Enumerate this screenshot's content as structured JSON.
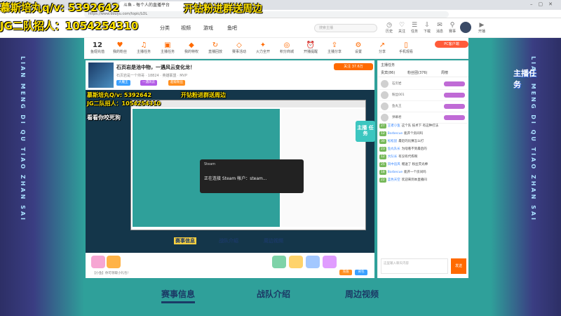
{
  "browser": {
    "tab_title": "斗鱼 - 每个人的直播平台",
    "url": "https://www.douyu.com/topic/LOL"
  },
  "overlay": {
    "line1_left": "慕斯培丸q/v:  5392642",
    "line1_right": "开钻粉进群送周边",
    "line2": "JG二队招人：1054254310",
    "inner_line1": "慕斯培丸Q/v: 5392642",
    "inner_line2": "JG二队招人：1054254310",
    "inner_right": "开钻粉进群送周边",
    "inner_small": "看看你咬死狗"
  },
  "header": {
    "logo": "斗鱼",
    "nav": [
      "分类",
      "视频",
      "游戏",
      "鱼吧"
    ],
    "search_placeholder": "搜索主播",
    "icons": [
      {
        "icon": "history-icon",
        "label": "历史"
      },
      {
        "icon": "follow-icon",
        "label": "关注"
      },
      {
        "icon": "task-icon",
        "label": "任务"
      },
      {
        "icon": "download-icon",
        "label": "下载"
      },
      {
        "icon": "message-icon",
        "label": "消息"
      },
      {
        "icon": "location-icon",
        "label": "赛事"
      },
      {
        "icon": "live-icon",
        "label": "开播"
      }
    ]
  },
  "toolbar": {
    "level": "12",
    "items": [
      "鱼翅充值",
      "我的粉丝",
      "主播任务",
      "主播任务",
      "我的特权",
      "直播回放",
      "赛事活动",
      "火力全开",
      "积分商城",
      "开播提醒",
      "主播分享",
      "设置",
      "分享",
      "手机观看",
      "更多"
    ],
    "pc_client": "PC客户端"
  },
  "room": {
    "title": "石页岩是池中物，一遇风云变化龙！",
    "meta": "石页岩是一个帅哥  ·  18824  ·  英雄联盟  ·  MVP",
    "tags": [
      "大魔王",
      "一遇风云",
      "超级粉丝"
    ],
    "follow": "关注 37.6万"
  },
  "video": {
    "dialog_title": "Steam",
    "dialog_msg": "正在连接 Steam 帐户：steam...",
    "tabs": [
      "赛事信息",
      "战队介绍",
      "周边视频"
    ]
  },
  "gifts": {
    "label": "【小鱼】你可领取小礼包!",
    "buttons": [
      "充值",
      "背包"
    ]
  },
  "chat": {
    "tabs": [
      "主播任务",
      "贵宾(86)",
      "粉丝团(376)",
      "周榜"
    ],
    "fans": [
      "石页岩",
      "粉丝001",
      "鱼丸王",
      "弹幕君"
    ],
    "messages": [
      {
        "level": "27",
        "user": "王者小鱼",
        "text": "这个队 技术下 有这种打法"
      },
      {
        "level": "12",
        "user": "Barbecue",
        "text": "能开个房间吗"
      },
      {
        "level": "30",
        "user": "松松鼠",
        "text": "最近的比赛怎么打"
      },
      {
        "level": "23",
        "user": "鱼丸队长",
        "text": "为啥看不到最后的"
      },
      {
        "level": "12",
        "user": "大队长",
        "text": "有没有代练啊"
      },
      {
        "level": "25",
        "user": "风中追风",
        "text": "赠送了 粉丝荧光棒"
      },
      {
        "level": "18",
        "user": "Barbecue",
        "text": "能开一个房间吗"
      },
      {
        "level": "22",
        "user": "蓝色天空",
        "text": "欢迎来到本直播间"
      }
    ],
    "input_placeholder": "这里输入聊天内容",
    "send": "发送"
  },
  "bottom_nav": [
    "赛事信息",
    "战队介绍",
    "周边视频"
  ],
  "side": {
    "promo": "主播任务",
    "live_badge": "主播 任务",
    "vertical_text": "LIAN MENG DI QU TIAO ZHAN SAI"
  }
}
